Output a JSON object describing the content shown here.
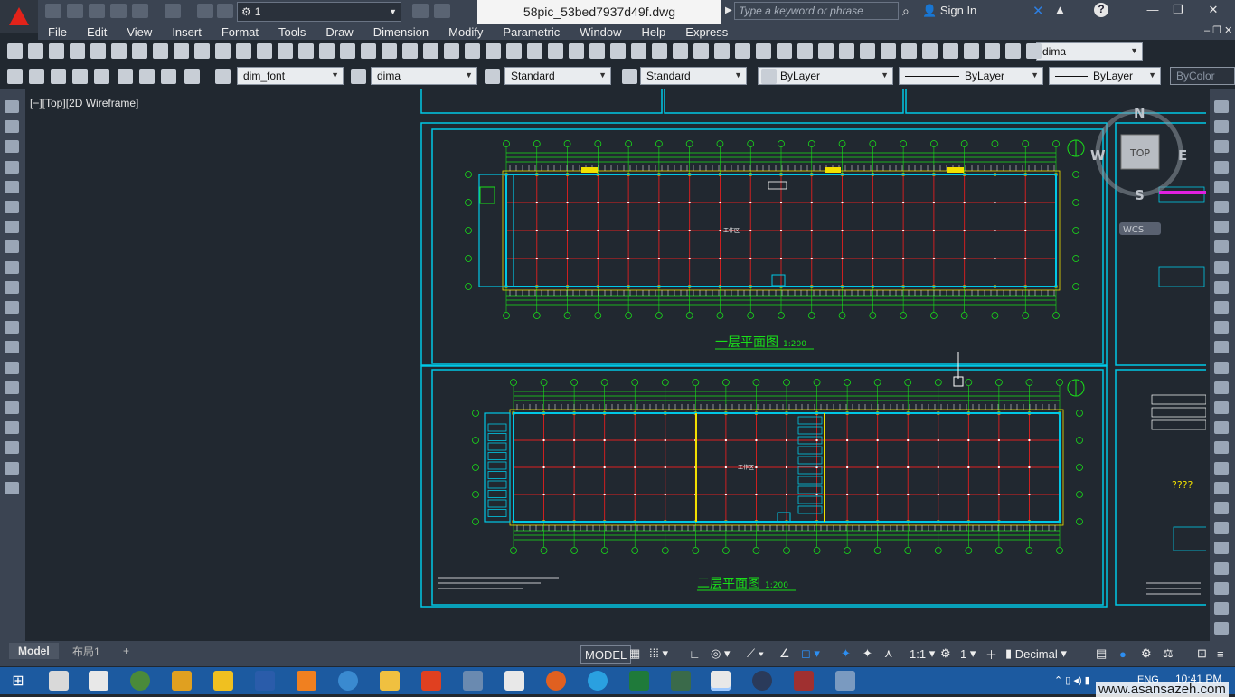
{
  "titlebar": {
    "workspace": "1",
    "file_name": "58pic_53bed7937d49f.dwg",
    "search_placeholder": "Type a keyword or phrase",
    "sign_in": "Sign In",
    "help": "?"
  },
  "menu": [
    "File",
    "Edit",
    "View",
    "Insert",
    "Format",
    "Tools",
    "Draw",
    "Dimension",
    "Modify",
    "Parametric",
    "Window",
    "Help",
    "Express"
  ],
  "toolbar2": {
    "dim_style": "dima"
  },
  "toolbar3": {
    "text_style": "dim_font",
    "dim_style": "dima",
    "table_style": "Standard",
    "multileader_style": "Standard",
    "color": "ByLayer",
    "linetype": "ByLayer",
    "lineweight": "ByLayer",
    "plot_style": "ByColor"
  },
  "viewport": {
    "label": "[−][Top][2D Wireframe]",
    "viewcube_face": "TOP",
    "compass": {
      "n": "N",
      "s": "S",
      "e": "E",
      "w": "W"
    },
    "ucs": "WCS",
    "drawings": {
      "plan1_title": "一层平面图",
      "plan1_scale": "1:200",
      "plan2_title": "二层平面图",
      "plan2_scale": "1:200",
      "center_text1": "工作区",
      "center_text2": "工作区",
      "side_caption": "????"
    }
  },
  "layout_tabs": {
    "model": "Model",
    "layout1": "布局1",
    "add": "+"
  },
  "statusbar": {
    "model": "MODEL",
    "scale": "1:1",
    "count": "1",
    "units": "Decimal"
  },
  "taskbar": {
    "lang": "ENG",
    "time": "10:41 PM",
    "watermark": "www.asansazeh.com"
  },
  "colors": {
    "frame": "#00c8e6",
    "grid": "#e01f1f",
    "green": "#19e019",
    "yellow": "#f0e000",
    "dim": "#d8d8d8"
  }
}
